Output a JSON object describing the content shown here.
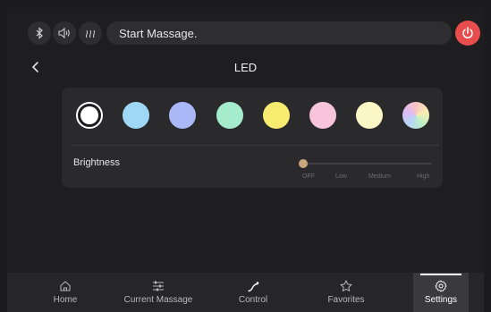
{
  "status": {
    "text": "Start Massage."
  },
  "header": {
    "title": "LED"
  },
  "led": {
    "swatches": [
      {
        "name": "white",
        "color": "#ffffff",
        "selected": true
      },
      {
        "name": "light-blue",
        "color": "#9fd8f5"
      },
      {
        "name": "periwinkle",
        "color": "#aab8f7"
      },
      {
        "name": "mint",
        "color": "#a5eccd"
      },
      {
        "name": "yellow",
        "color": "#f7ec70"
      },
      {
        "name": "pink",
        "color": "#f7c4dc"
      },
      {
        "name": "cream",
        "color": "#fbf6c5"
      },
      {
        "name": "rainbow",
        "color": "multicolor"
      }
    ],
    "brightness": {
      "label": "Brightness",
      "value": "OFF",
      "levels": [
        "OFF",
        "Low",
        "Medium",
        "High"
      ]
    }
  },
  "nav": {
    "items": [
      {
        "label": "Home",
        "icon": "home-icon"
      },
      {
        "label": "Current Massage",
        "icon": "sliders-icon"
      },
      {
        "label": "Control",
        "icon": "control-icon"
      },
      {
        "label": "Favorites",
        "icon": "star-icon"
      },
      {
        "label": "Settings",
        "icon": "gear-icon",
        "active": true
      }
    ]
  },
  "colors": {
    "power": "#e84d4d",
    "thumb": "#c9a57c"
  }
}
